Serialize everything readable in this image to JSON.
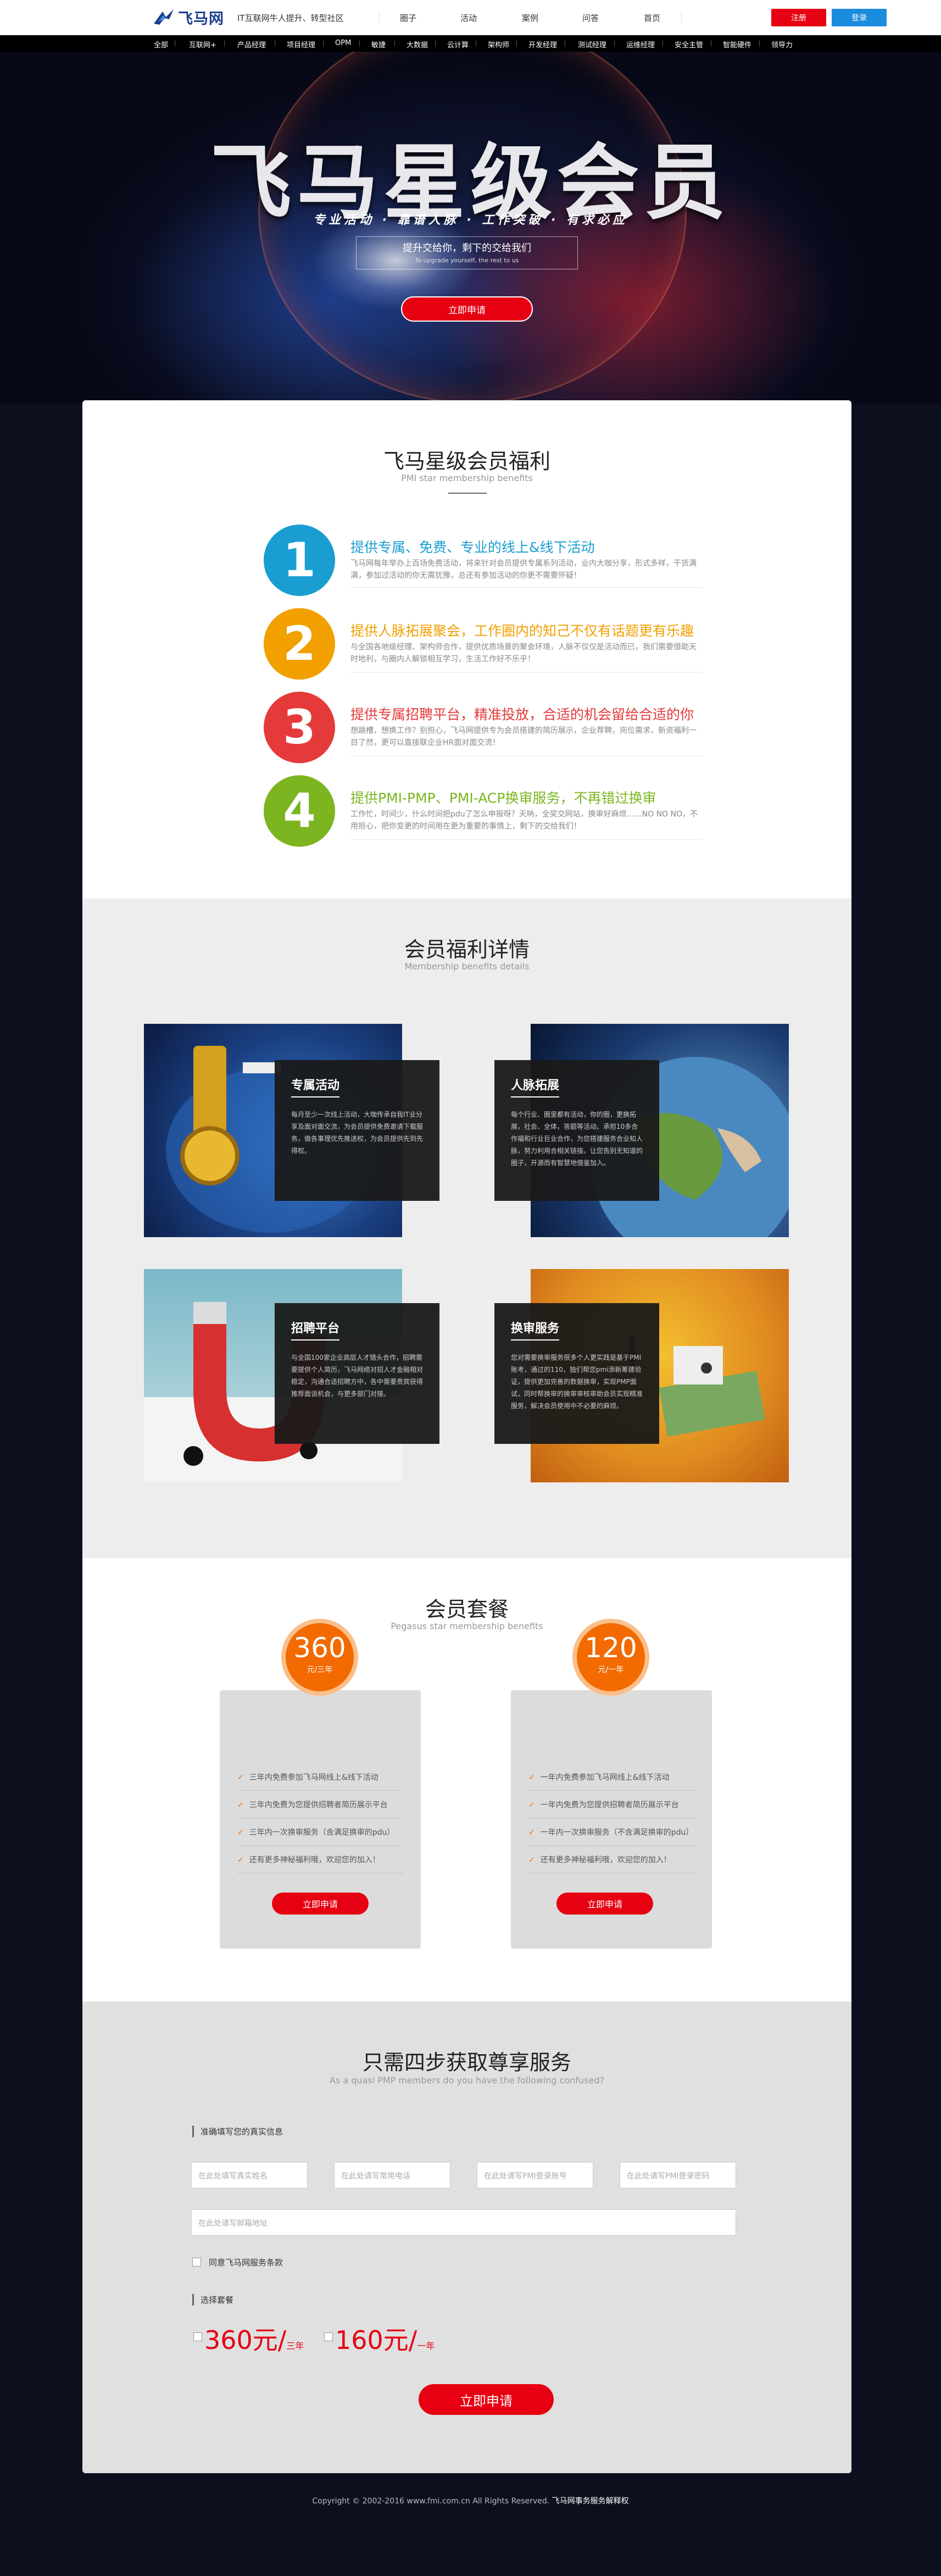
{
  "header": {
    "logo_text": "飞马网",
    "slogan": "IT互联网牛人提升、转型社区",
    "nav": [
      "圈子",
      "活动",
      "案例",
      "问答",
      "首页"
    ],
    "register_label": "注册",
    "login_label": "登录"
  },
  "categories": [
    "全部",
    "互联网+",
    "产品经理",
    "项目经理",
    "OPM",
    "敏捷",
    "大数据",
    "云计算",
    "架构师",
    "开发经理",
    "测试经理",
    "运维经理",
    "安全主管",
    "智能硬件",
    "领导力"
  ],
  "hero": {
    "title": "飞马星级会员",
    "subtitle": "专业活动 · 靠谱人脉 · 工作突破 · 有求必应",
    "box_line1": "提升交给你，剩下的交给我们",
    "box_line2": "To upgrade yourself, the rest to us",
    "button": "立即申请"
  },
  "benefits": {
    "title": "飞马星级会员福利",
    "subtitle": "PMI star membership benefits",
    "items": [
      {
        "num": "1",
        "title": "提供专属、免费、专业的线上&线下活动",
        "text": "飞马网每年举办上百场免费活动，将来针对会员提供专属系列活动，业内大咖分享，形式多样，干货满满，参加过活动的你无需犹豫，总还有参加活动的你更不需要怀疑！",
        "color": "#1a9ed1"
      },
      {
        "num": "2",
        "title": "提供人脉拓展聚会，工作圈内的知己不仅有话题更有乐趣",
        "text": "与全国各地级经理、架构师合作，提供优质场景的聚会环境，人脉不仅仅是活动而已，我们需要借助天时地利，与圈内人解锁相互学习，生活工作好不乐乎！",
        "color": "#f2a000"
      },
      {
        "num": "3",
        "title": "提供专属招聘平台，精准投放，合适的机会留给合适的你",
        "text": "想跳槽，想换工作？别担心，飞马网提供专为会员搭建的简历展示，企业荐聘，岗位需求，新资福利一目了然，更可以直接联企业HR面对面交流！",
        "color": "#e53a3a"
      },
      {
        "num": "4",
        "title": "提供PMI-PMP、PMI-ACP换审服务，不再错过换审",
        "text": "工作忙，时间少，什么时间把pdu了怎么申报呀？天呐，全奖交网站，换审好麻烦……NO NO NO，不用担心，把你变更的时间用在更为重要的事情上，剩下的交给我们！",
        "color": "#7cb51f"
      }
    ]
  },
  "details": {
    "title": "会员福利详情",
    "subtitle": "Membership benefits details",
    "cards": [
      {
        "title": "专属活动",
        "text": "每月至少一次线上活动，大咖传承自我IT业分享及面对面交流，为会员提供免费邀请下载服务，做各事理优先推送权，为会员提供先到先得权。"
      },
      {
        "title": "人脉拓展",
        "text": "每个行业、圈里都有活动，你的圈，更换拓展，社会、全体，答题等活动、承担10多合作福和行业巨业合作，为您搭建服务合业知人脉，努力利用合相关链接。让您告别无知道的圈子，开源而有智慧地借鉴加入。"
      },
      {
        "title": "招聘平台",
        "text": "与全国100家企业高层人才猎头合作，招聘需要提供个人简历，飞马网络对招人才金融相对稳定，沟通合适招聘方中，各中需要贵宾获得推荐面谈机会，与更多部门对接。"
      },
      {
        "title": "换审服务",
        "text": "您对需要换审服务很多个人更实践是基于PMI账考，通过的110，独们帮您pmi添新筹建验证，提供更加完善的数据换审，实现PMP面试，同时帮换审的换审审核审助会员实现精准服务，解决会员使用中不必要的麻烦。"
      }
    ]
  },
  "packages": {
    "title": "会员套餐",
    "subtitle": "Pegasus star membership benefits",
    "items": [
      {
        "price": "360",
        "unit": "元/三年",
        "features": [
          "三年内免费参加飞马网线上&线下活动",
          "三年内免费为您提供招聘者简历展示平台",
          "三年内一次换审服务（含满足换审的pdu）",
          "还有更多神秘福利哦，欢迎您的加入！"
        ],
        "button": "立即申请"
      },
      {
        "price": "120",
        "unit": "元/一年",
        "features": [
          "一年内免费参加飞马网线上&线下活动",
          "一年内免费为您提供招聘者简历展示平台",
          "一年内一次换审服务（不含满足换审的pdu）",
          "还有更多神秘福利哦，欢迎您的加入！"
        ],
        "button": "立即申请"
      }
    ]
  },
  "steps": {
    "title": "只需四步获取尊享服务",
    "subtitle": "As a quasi PMP members do you have the following confused?",
    "info_label": "准确填写您的真实信息",
    "placeholders": [
      "在此处填写真实姓名",
      "在此处请写常用电话",
      "在此处请写PMI登录账号",
      "在此处请写PMI登录密码"
    ],
    "email_placeholder": "在此处请写邮箱地址",
    "agree_label": "同意飞马网服务条款",
    "package_label": "选择套餐",
    "price1": "360元/",
    "price1_unit": "三年",
    "price2": "160元/",
    "price2_unit": "一年",
    "submit": "立即申请"
  },
  "footer": {
    "copyright": "Copyright © 2002-2016 www.fmi.com.cn All Rights Reserved.",
    "company": "飞马网事务服务解释权"
  }
}
